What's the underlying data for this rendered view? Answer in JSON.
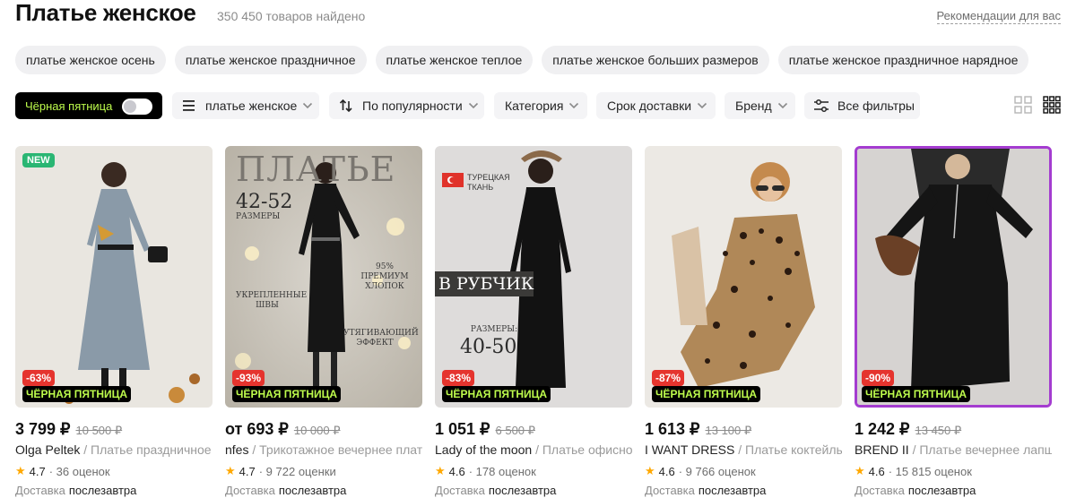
{
  "header": {
    "title": "Платье женское",
    "found": "350 450 товаров найдено",
    "recommendations": "Рекомендации для вас"
  },
  "chips": [
    "платье женское осень",
    "платье женское праздничное",
    "платье женское теплое",
    "платье женское больших размеров",
    "платье женское праздничное нарядное"
  ],
  "filters": {
    "black_friday": "Чёрная пятница",
    "query": "платье женское",
    "sort": "По популярности",
    "category": "Категория",
    "delivery": "Срок доставки",
    "brand": "Бренд",
    "all": "Все фильтры"
  },
  "colors": {
    "accent_green": "#bdfb4c",
    "discount_red": "#e5342e",
    "new_green": "#2ab673",
    "selected_purple": "#a43cd0",
    "star": "#ffa800"
  },
  "labels": {
    "black_friday_badge": "ЧЁРНАЯ ПЯТНИЦА",
    "delivery": "Доставка"
  },
  "products": [
    {
      "new_badge": "NEW",
      "discount": "-63%",
      "price": "3 799 ₽",
      "old_price": "10 500 ₽",
      "brand": "Olga Peltek",
      "name": " / Платье праздничное",
      "rating": "4.7",
      "reviews": "· 36 оценок",
      "delivery": "послезавтра"
    },
    {
      "promo_title": "ПЛАТЬЕ",
      "promo_sizes": "42-52",
      "promo_sizes_label": "РАЗМЕРЫ",
      "promo_cotton": "95% ПРЕМИУМ ХЛОПОК",
      "promo_seams": "УКРЕПЛЕННЫЕ ШВЫ",
      "promo_effect": "УТЯГИВАЮЩИЙ ЭФФЕКТ",
      "discount": "-93%",
      "price": "от 693 ₽",
      "old_price": "10 000 ₽",
      "brand": "nfes",
      "name": " / Трикотажное вечернее платье",
      "rating": "4.7",
      "reviews": "· 9 722 оценки",
      "delivery": "послезавтра"
    },
    {
      "promo_fabric": "ТУРЕЦКАЯ ТКАНЬ",
      "promo_rib": "В РУБЧИК",
      "promo_sizes_label": "РАЗМЕРЫ:",
      "promo_sizes": "40-50",
      "discount": "-83%",
      "price": "1 051 ₽",
      "old_price": "6 500 ₽",
      "brand": "Lady of the moon",
      "name": " / Платье офисное",
      "rating": "4.6",
      "reviews": "· 178 оценок",
      "delivery": "послезавтра"
    },
    {
      "discount": "-87%",
      "price": "1 613 ₽",
      "old_price": "13 100 ₽",
      "brand": "I WANT DRESS",
      "name": " / Платье коктейльное",
      "rating": "4.6",
      "reviews": "· 9 766 оценок",
      "delivery": "послезавтра"
    },
    {
      "discount": "-90%",
      "price": "1 242 ₽",
      "old_price": "13 450 ₽",
      "brand": "BREND II",
      "name": " / Платье вечернее лапша",
      "rating": "4.6",
      "reviews": "· 15 815 оценок",
      "delivery": "послезавтра"
    }
  ]
}
